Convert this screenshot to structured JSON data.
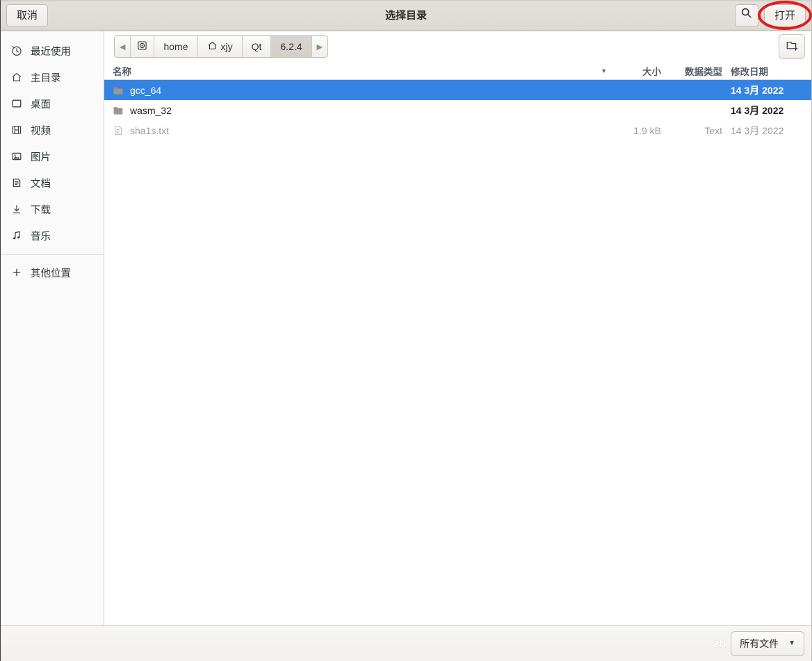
{
  "window": {
    "title": "选择目录"
  },
  "header": {
    "cancel_label": "取消",
    "open_label": "打开",
    "search_icon": "search-icon",
    "accent_selection": "#3584e4",
    "annotation_color": "#e01b1b"
  },
  "pathbar": {
    "prev_arrow": "◀",
    "next_arrow": "▶",
    "segments": [
      {
        "label": "",
        "icon": "disk-icon",
        "active": false
      },
      {
        "label": "home",
        "icon": "",
        "active": false
      },
      {
        "label": "xjy",
        "icon": "home-icon",
        "active": false
      },
      {
        "label": "Qt",
        "icon": "",
        "active": false
      },
      {
        "label": "6.2.4",
        "icon": "",
        "active": true
      }
    ],
    "new_folder_icon": "new-folder-icon"
  },
  "sidebar": {
    "items": [
      {
        "label": "最近使用",
        "icon": "clock-icon"
      },
      {
        "label": "主目录",
        "icon": "home-icon"
      },
      {
        "label": "桌面",
        "icon": "desktop-icon"
      },
      {
        "label": "视频",
        "icon": "video-icon"
      },
      {
        "label": "图片",
        "icon": "image-icon"
      },
      {
        "label": "文档",
        "icon": "document-icon"
      },
      {
        "label": "下载",
        "icon": "download-icon"
      },
      {
        "label": "音乐",
        "icon": "music-icon"
      }
    ],
    "other_locations": {
      "label": "其他位置",
      "icon": "plus-icon"
    }
  },
  "filelist": {
    "columns": {
      "name": "名称",
      "size": "大小",
      "type": "数据类型",
      "date": "修改日期"
    },
    "sort_caret": "▼",
    "rows": [
      {
        "name": "gcc_64",
        "size": "",
        "type": "",
        "date": "14 3月 2022",
        "icon": "folder-icon",
        "selected": true,
        "dim": false
      },
      {
        "name": "wasm_32",
        "size": "",
        "type": "",
        "date": "14 3月 2022",
        "icon": "folder-icon",
        "selected": false,
        "dim": false
      },
      {
        "name": "sha1s.txt",
        "size": "1.9 kB",
        "type": "Text",
        "date": "14 3月 2022",
        "icon": "text-file-icon",
        "selected": false,
        "dim": true
      }
    ]
  },
  "actionbar": {
    "filter_label": "所有文件",
    "filter_caret": "▼",
    "ime_overlay": "zh"
  }
}
